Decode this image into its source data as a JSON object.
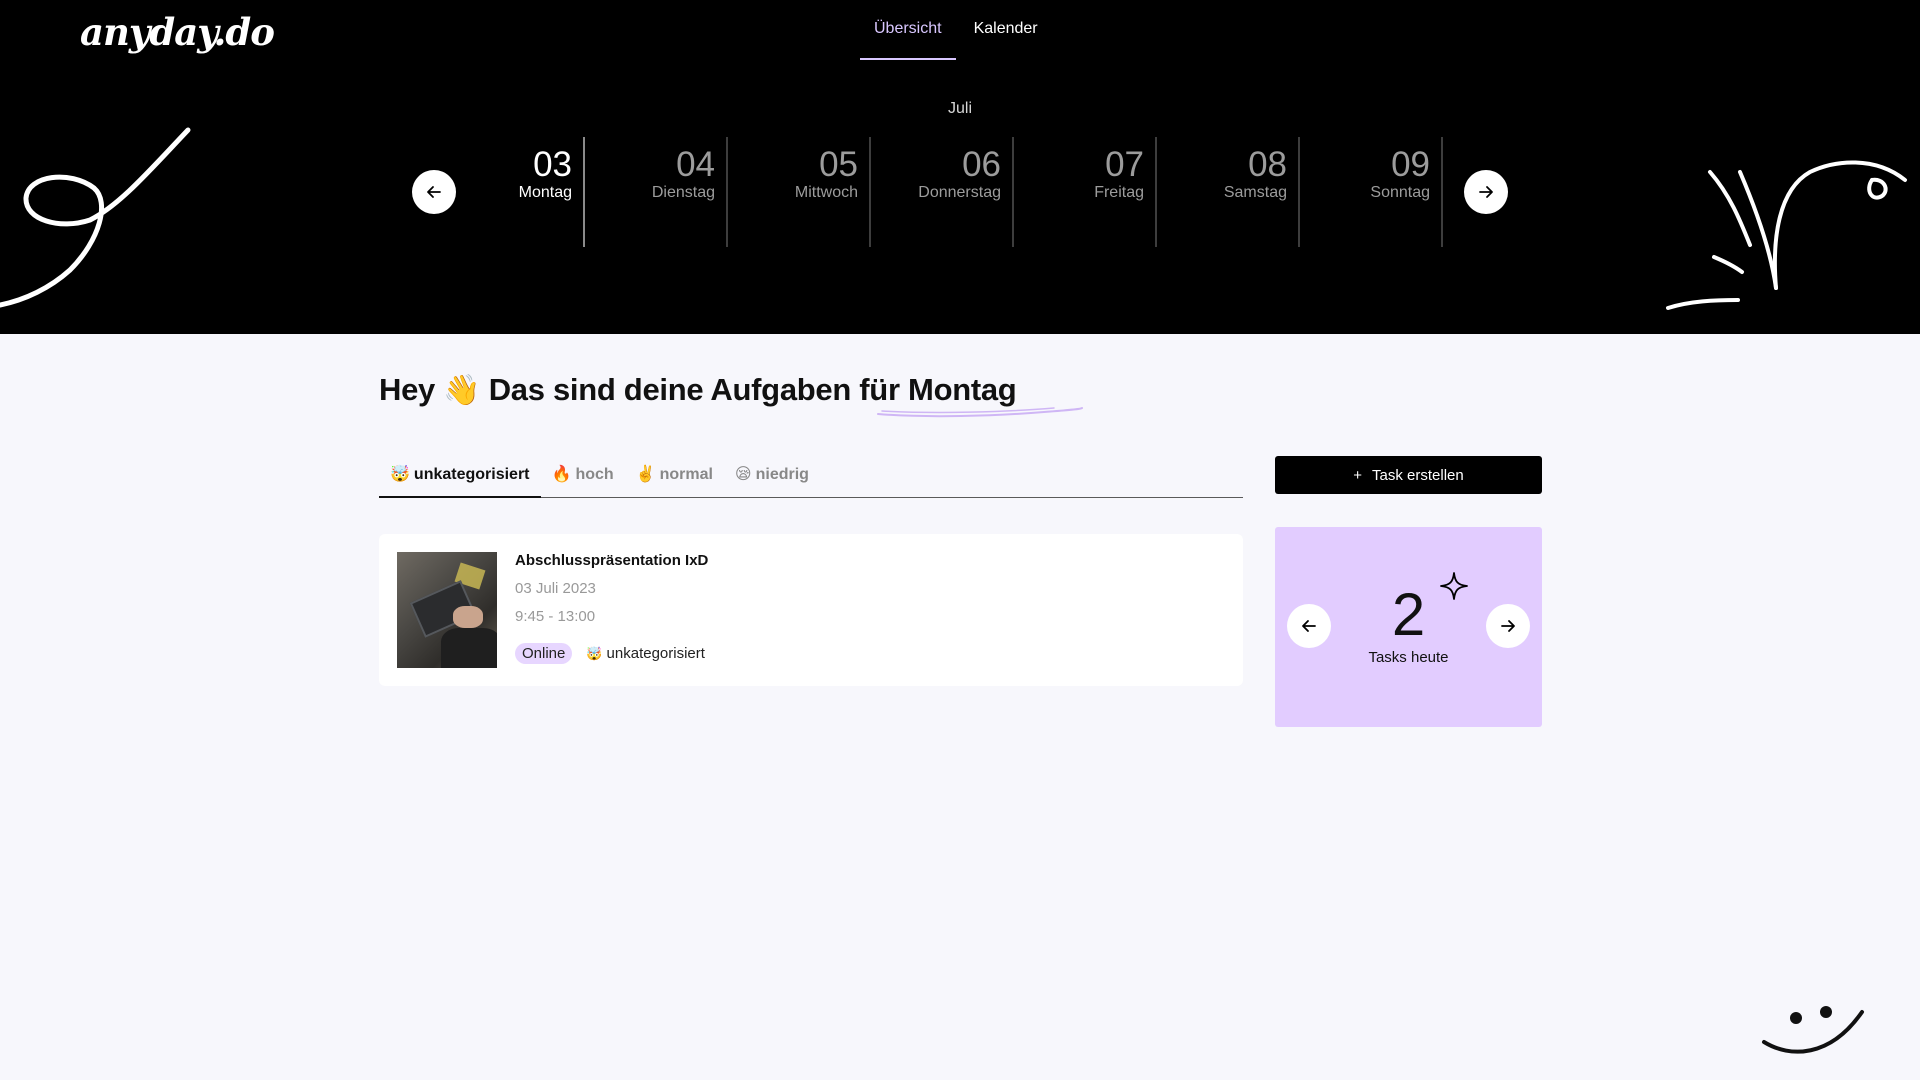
{
  "app": {
    "logo": "anyday.do"
  },
  "nav": {
    "tabs": [
      {
        "label": "Übersicht",
        "active": true
      },
      {
        "label": "Kalender",
        "active": false
      }
    ]
  },
  "week": {
    "month": "Juli",
    "days": [
      {
        "num": "03",
        "name": "Montag",
        "active": true
      },
      {
        "num": "04",
        "name": "Dienstag"
      },
      {
        "num": "05",
        "name": "Mittwoch"
      },
      {
        "num": "06",
        "name": "Donnerstag"
      },
      {
        "num": "07",
        "name": "Freitag"
      },
      {
        "num": "08",
        "name": "Samstag"
      },
      {
        "num": "09",
        "name": "Sonntag"
      }
    ]
  },
  "headline": {
    "prefix": "Hey",
    "wave": "👋",
    "middle": "Das sind deine Aufgaben für",
    "day": "Montag"
  },
  "tabs": [
    {
      "emoji": "🤯",
      "label": "unkategorisiert",
      "active": true
    },
    {
      "emoji": "🔥",
      "label": "hoch"
    },
    {
      "emoji": "✌️",
      "label": "normal"
    },
    {
      "emoji": "😪",
      "label": "niedrig"
    }
  ],
  "task": {
    "title": "Abschlusspräsentation IxD",
    "date": "03 Juli 2023",
    "time": "9:45 - 13:00",
    "location_badge": "Online",
    "category_emoji": "🤯",
    "category": "unkategorisiert"
  },
  "create_button": {
    "plus": "+",
    "label": "Task erstellen"
  },
  "counter": {
    "value": "2",
    "label": "Tasks heute"
  },
  "icons": {
    "week_prev": "arrow-left-icon",
    "week_next": "arrow-right-icon",
    "counter_prev": "arrow-left-icon",
    "counter_next": "arrow-right-icon",
    "sparkle": "sparkle-icon"
  },
  "colors": {
    "accent_purple": "#e2ccff",
    "badge_purple": "#e7d6ff",
    "header_bg": "#000000",
    "page_bg": "#f7f7fc"
  }
}
